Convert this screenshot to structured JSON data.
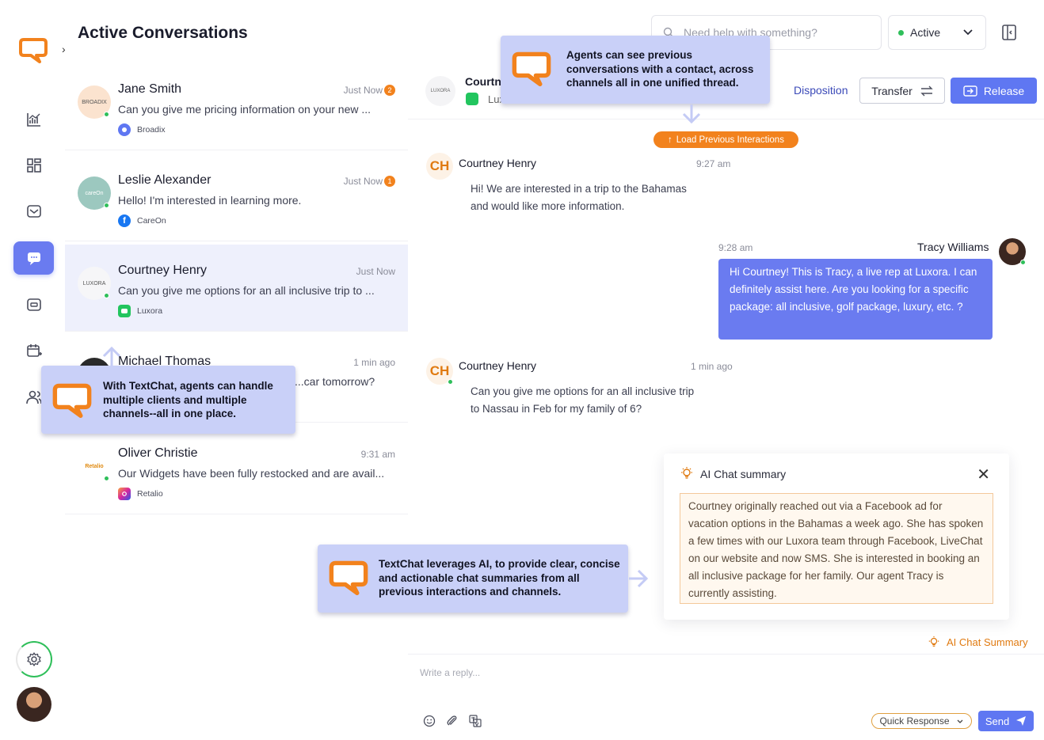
{
  "list": {
    "title": "Active Conversations",
    "conversations": [
      {
        "name": "Jane Smith",
        "time": "Just Now",
        "badge": "2",
        "message": "Can you give me pricing information on your new ...",
        "channel": "Broadix",
        "avatar_text": "BROADIX"
      },
      {
        "name": "Leslie Alexander",
        "time": "Just Now",
        "badge": "1",
        "message": "Hello! I'm interested in learning more.",
        "channel": "CareOn",
        "avatar_text": "careOn"
      },
      {
        "name": "Courtney Henry",
        "time": "Just Now",
        "badge": "",
        "message": "Can you give me options for an all inclusive trip to ...",
        "channel": "Luxora",
        "avatar_text": "LUXORA"
      },
      {
        "name": "Michael Thomas",
        "time": "1 min ago",
        "badge": "",
        "message": "...car tomorrow?",
        "channel": "",
        "avatar_text": ""
      },
      {
        "name": "Oliver Christie",
        "time": "9:31 am",
        "badge": "",
        "message": "Our Widgets have been fully restocked and are avail...",
        "channel": "Retalio",
        "avatar_text": "Retalio"
      }
    ]
  },
  "header": {
    "search_placeholder": "Need help with something?",
    "status": "Active"
  },
  "chat": {
    "contact_name": "Courtn",
    "contact_channel": "Luxora",
    "contact_avatar_text": "LUXORA",
    "disposition_label": "Disposition",
    "transfer_label": "Transfer",
    "release_label": "Release",
    "load_previous_label": "Load Previous Interactions",
    "messages": [
      {
        "initials": "CH",
        "name": "Courtney Henry",
        "time": "9:27 am",
        "line1": "Hi! We are interested in a trip to the Bahamas",
        "line2": "and would like more information."
      },
      {
        "name": "Tracy Williams",
        "time": "9:28 am",
        "text": "Hi Courtney! This is Tracy, a live rep at Luxora. I can definitely assist here. Are you looking for a specific package: all inclusive, golf package, luxury, etc. ?"
      },
      {
        "initials": "CH",
        "name": "Courtney Henry",
        "time": "1 min ago",
        "line1": "Can you give me options for an all inclusive trip",
        "line2": "to Nassau in Feb for my family of 6?"
      }
    ]
  },
  "summary": {
    "title": "AI Chat summary",
    "close": "✕",
    "body": "Courtney originally reached out via a Facebook ad for vacation options in the Bahamas a week ago. She has spoken a few times with our Luxora team through Facebook, LiveChat on our website and now SMS. She is interested in booking an all inclusive package for her family. Our agent Tracy is currently assisting.",
    "link_label": "AI Chat Summary"
  },
  "composer": {
    "placeholder": "Write a reply...",
    "quick_response_label": "Quick Response",
    "send_label": "Send"
  },
  "callouts": {
    "previous": "Agents can see previous conversations with a contact, across channels all in one unified thread.",
    "multi": "With TextChat, agents can handle multiple clients and multiple channels--all in one place.",
    "ai": "TextChat leverages AI, to provide clear, concise and actionable chat summaries from all previous interactions and channels."
  },
  "colors": {
    "brand_orange": "#f2821d",
    "accent_blue": "#5f77f2",
    "bubble_blue": "#6a7bf0",
    "callout_bg": "#c9d0f8",
    "online_green": "#2fbf5a"
  },
  "icons": [
    "brand-logo-icon",
    "chevron-right-icon",
    "analytics-icon",
    "dashboard-icon",
    "inbox-icon",
    "chat-icon",
    "ticket-icon",
    "calendar-add-icon",
    "contacts-icon",
    "gear-icon",
    "search-icon",
    "chevron-down-icon",
    "panel-toggle-icon",
    "transfer-icon",
    "release-icon",
    "lightbulb-icon",
    "emoji-icon",
    "attachment-icon",
    "translate-icon",
    "send-icon"
  ]
}
